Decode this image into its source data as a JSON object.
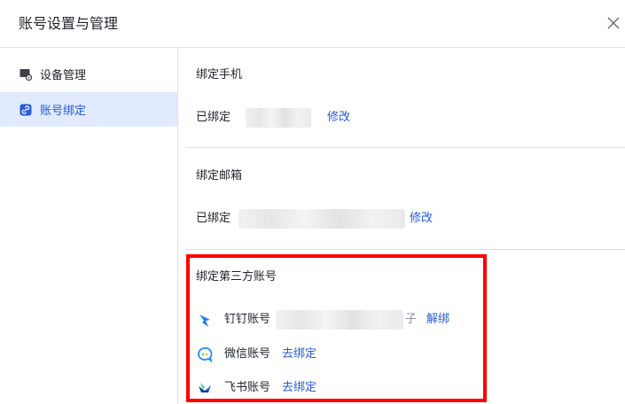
{
  "dialog": {
    "title": "账号设置与管理"
  },
  "sidebar": {
    "items": [
      {
        "label": "设备管理",
        "icon": "device-icon",
        "active": false
      },
      {
        "label": "账号绑定",
        "icon": "link-icon",
        "active": true
      }
    ]
  },
  "phone": {
    "section_title": "绑定手机",
    "status": "已绑定",
    "action": "修改"
  },
  "email": {
    "section_title": "绑定邮箱",
    "status": "已绑定",
    "action": "修改"
  },
  "third_party": {
    "section_title": "绑定第三方账号",
    "accounts": [
      {
        "label": "钉钉账号",
        "icon": "dingtalk-icon",
        "action": "解绑",
        "blurred_suffix": "子"
      },
      {
        "label": "微信账号",
        "icon": "wechat-icon",
        "action": "去绑定"
      },
      {
        "label": "飞书账号",
        "icon": "feishu-icon",
        "action": "去绑定"
      }
    ]
  },
  "colors": {
    "accent": "#245bdb",
    "active_bg": "#e1eaff",
    "highlight": "#ff0000"
  }
}
